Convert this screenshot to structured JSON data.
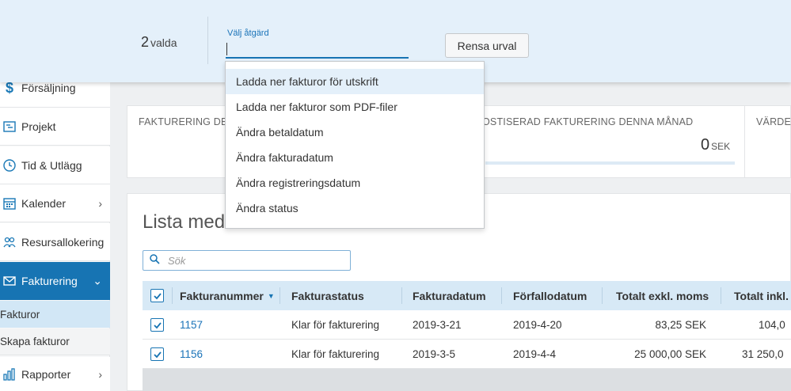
{
  "sidebar": {
    "items": [
      {
        "label": "Försäljning",
        "icon": "dollar-icon"
      },
      {
        "label": "Projekt",
        "icon": "project-icon"
      },
      {
        "label": "Tid & Utlägg",
        "icon": "clock-icon"
      },
      {
        "label": "Kalender",
        "icon": "calendar-icon"
      },
      {
        "label": "Resursallokering",
        "icon": "people-icon"
      },
      {
        "label": "Fakturering",
        "icon": "envelope-icon"
      },
      {
        "label": "Rapporter",
        "icon": "bar-chart-icon"
      }
    ],
    "subitems": [
      {
        "label": "Fakturor"
      },
      {
        "label": "Skapa fakturor"
      }
    ]
  },
  "kpis": [
    {
      "label": "FAKTURERING DE"
    },
    {
      "label": "OSTISERAD FAKTURERING DENNA MÅNAD",
      "value": "0",
      "unit": "SEK"
    },
    {
      "label": "VÄRDET"
    }
  ],
  "list": {
    "title": "Lista med fakturor",
    "search_placeholder": "Sök",
    "columns": [
      "Fakturanummer",
      "Fakturastatus",
      "Fakturadatum",
      "Förfallodatum",
      "Totalt exkl. moms",
      "Totalt inkl."
    ],
    "rows": [
      {
        "number": "1157",
        "status": "Klar för fakturering",
        "date": "2019-3-21",
        "due": "2019-4-20",
        "excl": "83,25 SEK",
        "incl": "104,0"
      },
      {
        "number": "1156",
        "status": "Klar för fakturering",
        "date": "2019-3-5",
        "due": "2019-4-4",
        "excl": "25 000,00 SEK",
        "incl": "31 250,0"
      }
    ]
  },
  "topbar": {
    "count": "2",
    "count_label": "valda",
    "action_label": "Välj åtgärd",
    "clear_button": "Rensa urval"
  },
  "dropdown": {
    "options": [
      "Ladda ner fakturor för utskrift",
      "Ladda ner fakturor som PDF-filer",
      "Ändra betaldatum",
      "Ändra fakturadatum",
      "Ändra registreringsdatum",
      "Ändra status"
    ]
  },
  "colors": {
    "accent": "#1774b3",
    "link": "#1a73b8",
    "header_bg": "#d7e9f6",
    "topbar_bg": "#e4f0fa"
  }
}
